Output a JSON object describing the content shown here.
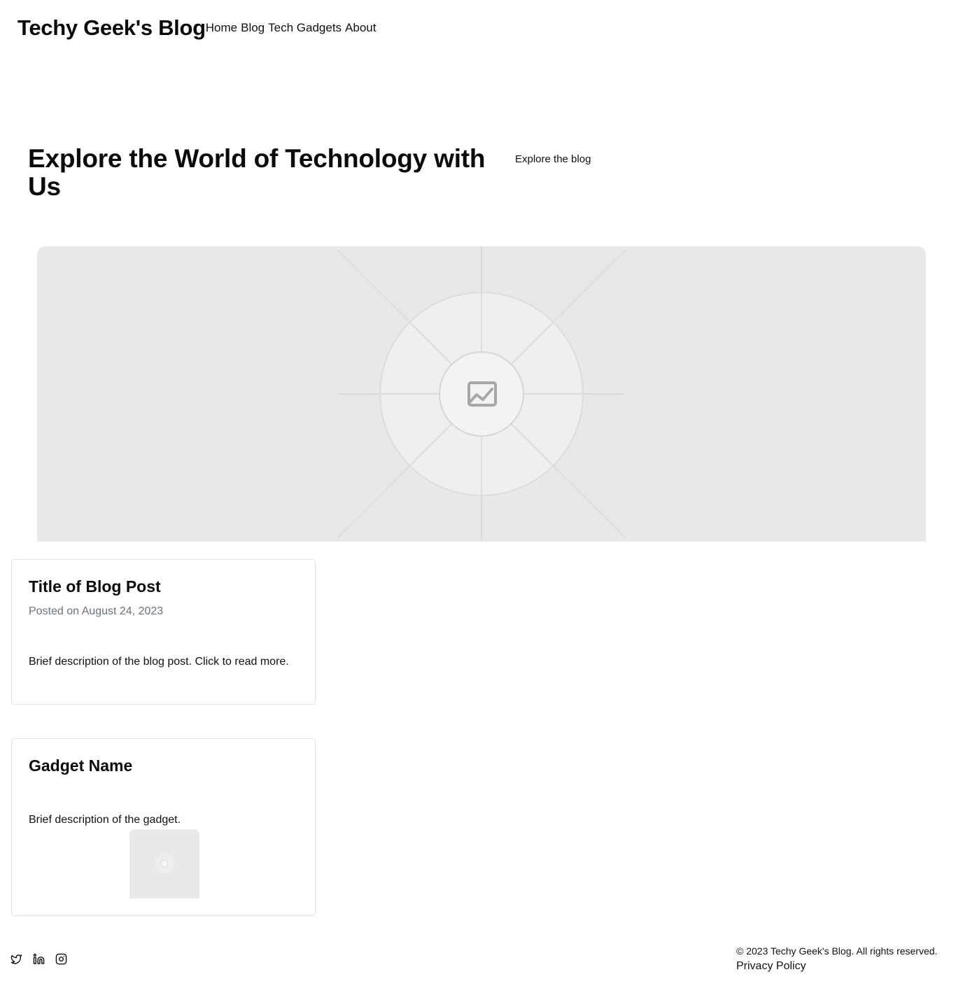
{
  "header": {
    "site_title": "Techy Geek's Blog",
    "nav": [
      {
        "label": "Home"
      },
      {
        "label": "Blog"
      },
      {
        "label": "Tech Gadgets"
      },
      {
        "label": "About"
      }
    ]
  },
  "hero": {
    "heading": "Explore the World of Technology with Us",
    "cta_label": "Explore the blog",
    "image_icon": "image-placeholder-icon"
  },
  "blog_card": {
    "title": "Title of Blog Post",
    "date": "Posted on August 24, 2023",
    "description": "Brief description of the blog post. Click to read more."
  },
  "gadget_card": {
    "title": "Gadget Name",
    "description": "Brief description of the gadget.",
    "image_icon": "image-placeholder-icon"
  },
  "footer": {
    "social": [
      {
        "icon": "twitter-icon"
      },
      {
        "icon": "linkedin-icon"
      },
      {
        "icon": "instagram-icon"
      }
    ],
    "copyright": "© 2023 Techy Geek's Blog. All rights reserved.",
    "privacy_label": "Privacy Policy"
  },
  "colors": {
    "text": "#111111",
    "muted": "#6b7280",
    "placeholder_bg": "#e8e8e8",
    "card_border": "#e3e3e3"
  }
}
